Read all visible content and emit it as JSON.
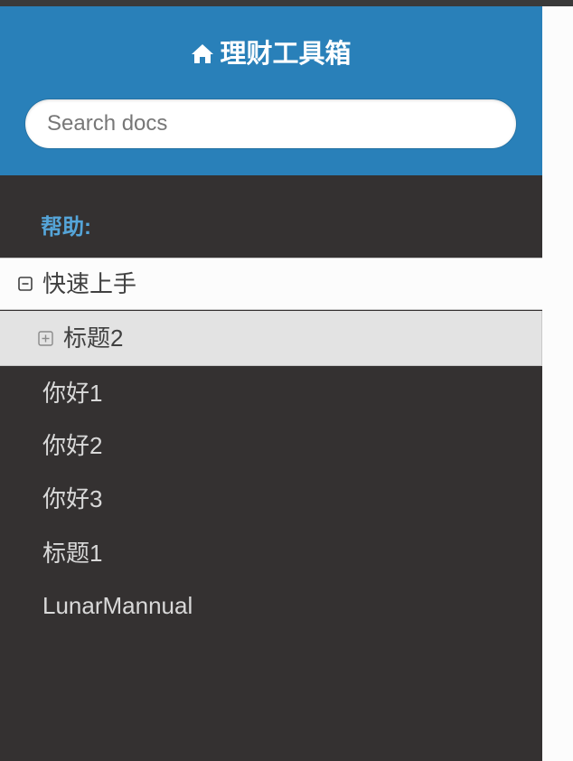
{
  "header": {
    "brand_icon": "home-icon",
    "brand_title": "理财工具箱"
  },
  "search": {
    "placeholder": "Search docs"
  },
  "nav": {
    "caption": "帮助:",
    "current": {
      "label": "快速上手",
      "toggle_icon": "minus-square-icon"
    },
    "current_child": {
      "label": "标题2",
      "toggle_icon": "plus-square-icon"
    },
    "links": [
      "你好1",
      "你好2",
      "你好3",
      "标题1",
      "LunarMannual"
    ]
  },
  "colors": {
    "header_blue": "#2980b9",
    "sidebar_dark": "#343131",
    "caption_blue": "#55a5d9",
    "current_bg": "#fcfcfc",
    "child_bg": "#e3e3e3"
  }
}
